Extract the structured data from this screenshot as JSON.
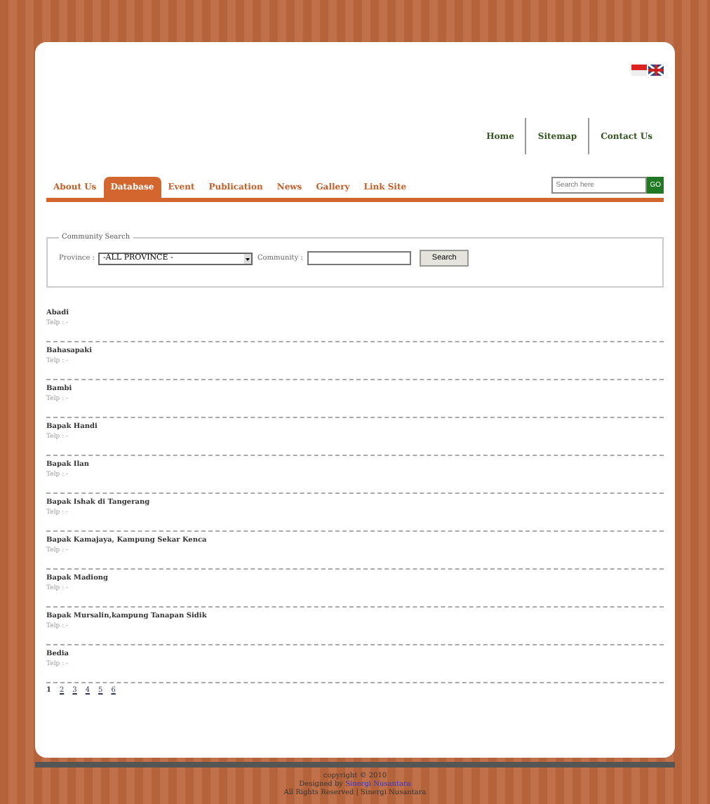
{
  "top_links": [
    {
      "label": "Home"
    },
    {
      "label": "Sitemap"
    },
    {
      "label": "Contact Us"
    }
  ],
  "tabs": [
    {
      "label": "About Us",
      "selected": false
    },
    {
      "label": "Database",
      "selected": true
    },
    {
      "label": "Event",
      "selected": false
    },
    {
      "label": "Publication",
      "selected": false
    },
    {
      "label": "News",
      "selected": false
    },
    {
      "label": "Gallery",
      "selected": false
    },
    {
      "label": "Link Site",
      "selected": false
    }
  ],
  "site_search": {
    "placeholder": "Search here",
    "button": "GO"
  },
  "community_search": {
    "legend": "Community Search",
    "province_label": "Province :",
    "province_value": "-ALL PROVINCE -",
    "community_label": "Community :",
    "button": "Search"
  },
  "communities": [
    {
      "name": "Abadi",
      "detail": "Telp : -"
    },
    {
      "name": "Bahasapaki",
      "detail": "Telp : -"
    },
    {
      "name": "Bambi",
      "detail": "Telp : -"
    },
    {
      "name": "Bapak Handi",
      "detail": "Telp : -"
    },
    {
      "name": "Bapak Ilan",
      "detail": "Telp : -"
    },
    {
      "name": "Bapak Ishak di Tangerang",
      "detail": "Telp : -"
    },
    {
      "name": "Bapak Kamajaya, Kampung Sekar Kenca",
      "detail": "Telp : -"
    },
    {
      "name": "Bapak Madiong",
      "detail": "Telp : -"
    },
    {
      "name": "Bapak Mursalin,kampung Tanapan Sidik",
      "detail": "Telp : -"
    },
    {
      "name": "Bedia",
      "detail": "Telp : -"
    }
  ],
  "pagination": [
    {
      "label": "1",
      "selected": true
    },
    {
      "label": "2",
      "selected": false
    },
    {
      "label": "3",
      "selected": false
    },
    {
      "label": "4",
      "selected": false
    },
    {
      "label": "5",
      "selected": false
    },
    {
      "label": "6",
      "selected": false
    }
  ],
  "footer": {
    "copyright": "copyright © 2010",
    "credit_prefix": "Designed by",
    "credit_link": "Sinergi Nusantara",
    "rights": "All Rights Reserved | Sinergi Nusantara"
  }
}
